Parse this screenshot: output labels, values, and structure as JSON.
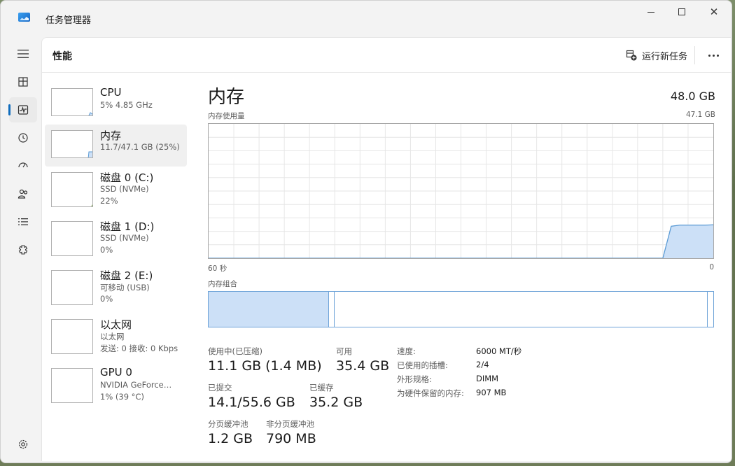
{
  "window": {
    "title": "任务管理器",
    "minimize_icon": "minimize-icon",
    "maximize_icon": "maximize-icon",
    "close_label": "✕"
  },
  "nav": [
    {
      "icon": "hamburger-icon",
      "name": "nav-menu-button"
    },
    {
      "icon": "processes-icon",
      "name": "nav-processes"
    },
    {
      "icon": "performance-icon",
      "name": "nav-performance",
      "active": true
    },
    {
      "icon": "history-icon",
      "name": "nav-app-history"
    },
    {
      "icon": "startup-icon",
      "name": "nav-startup-apps"
    },
    {
      "icon": "users-icon",
      "name": "nav-users"
    },
    {
      "icon": "details-icon",
      "name": "nav-details"
    },
    {
      "icon": "services-icon",
      "name": "nav-services"
    },
    {
      "icon": "settings-icon",
      "name": "nav-settings"
    }
  ],
  "header": {
    "title": "性能",
    "run_task_label": "运行新任务",
    "more_icon": "more-icon"
  },
  "sidebar": {
    "items": [
      {
        "name": "CPU",
        "line1": "5%  4.85 GHz",
        "line2": "",
        "level": 0.05
      },
      {
        "name": "内存",
        "line1": "11.7/47.1 GB (25%)",
        "line2": "",
        "level": 0.25,
        "selected": true
      },
      {
        "name": "磁盘 0 (C:)",
        "line1": "SSD (NVMe)",
        "line2": "22%",
        "level": 0.22
      },
      {
        "name": "磁盘 1 (D:)",
        "line1": "SSD (NVMe)",
        "line2": "0%",
        "level": 0
      },
      {
        "name": "磁盘 2 (E:)",
        "line1": "可移动 (USB)",
        "line2": "0%",
        "level": 0
      },
      {
        "name": "以太网",
        "line1": "以太网",
        "line2": "发送: 0 接收: 0 Kbps",
        "level": 0
      },
      {
        "name": "GPU 0",
        "line1": "NVIDIA GeForce…",
        "line2": "1% (39 °C)",
        "level": 0.01
      }
    ]
  },
  "main": {
    "title": "内存",
    "total": "48.0 GB",
    "usage_label": "内存使用量",
    "usage_max": "47.1 GB",
    "axis_left": "60 秒",
    "axis_right": "0",
    "composition_label": "内存组合",
    "composition": {
      "in_use_fraction": 0.239,
      "modified_fraction": 0.011,
      "free_fraction": 0.0125
    },
    "stats": {
      "in_use_label": "使用中(已压缩)",
      "in_use_value": "11.1 GB (1.4 MB)",
      "available_label": "可用",
      "available_value": "35.4 GB",
      "committed_label": "已提交",
      "committed_value": "14.1/55.6 GB",
      "cached_label": "已缓存",
      "cached_value": "35.2 GB",
      "paged_label": "分页缓冲池",
      "paged_value": "1.2 GB",
      "nonpaged_label": "非分页缓冲池",
      "nonpaged_value": "790 MB"
    },
    "details": [
      {
        "label": "速度:",
        "value": "6000 MT/秒"
      },
      {
        "label": "已使用的插槽:",
        "value": "2/4"
      },
      {
        "label": "外形规格:",
        "value": "DIMM"
      },
      {
        "label": "为硬件保留的内存:",
        "value": "907 MB"
      }
    ]
  },
  "chart_data": {
    "type": "area",
    "title": "内存使用量",
    "xlabel": "",
    "ylabel": "",
    "x": [
      60,
      57,
      54,
      51,
      48,
      45,
      42,
      39,
      36,
      33,
      30,
      27,
      24,
      21,
      18,
      15,
      12,
      9,
      6,
      5,
      4,
      3,
      2,
      1,
      0
    ],
    "xlim": [
      60,
      0
    ],
    "ylim": [
      0,
      47.1
    ],
    "series": [
      {
        "values": [
          0,
          0,
          0,
          0,
          0,
          0,
          0,
          0,
          0,
          0,
          0,
          0,
          0,
          0,
          0,
          0,
          0,
          0,
          0,
          11.2,
          11.6,
          11.6,
          11.6,
          11.6,
          11.7
        ]
      }
    ],
    "grid": true,
    "colors": {
      "line": "#5b9bd5",
      "fill": "#cce0f7",
      "grid": "#e6e6e6"
    }
  }
}
